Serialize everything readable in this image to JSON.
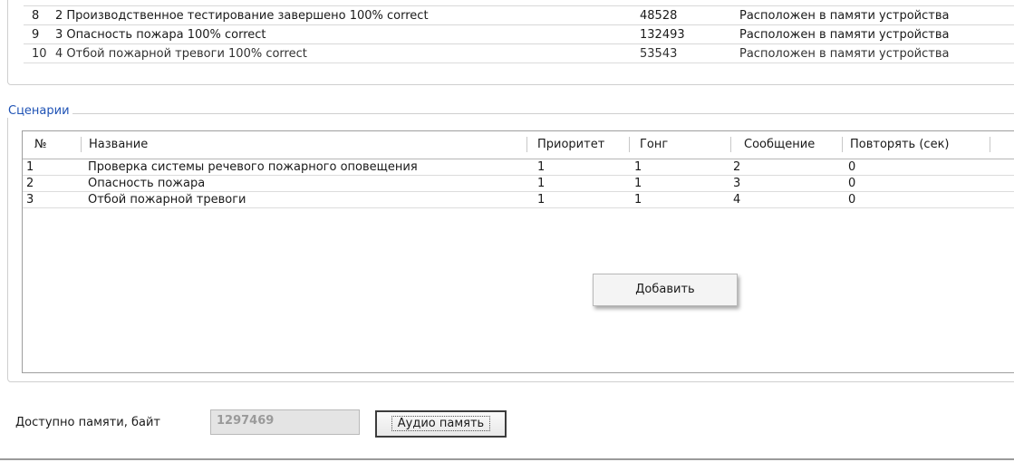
{
  "messages": {
    "rows": [
      {
        "num": "8",
        "name": "2 Производственное тестирование завершено 100% correct",
        "size": "48528",
        "location": "Расположен в памяти устройства"
      },
      {
        "num": "9",
        "name": "3 Опасность пожара 100% correct",
        "size": "132493",
        "location": "Расположен в памяти устройства"
      },
      {
        "num": "10",
        "name": "4 Отбой пожарной тревоги 100% correct",
        "size": "53543",
        "location": "Расположен в памяти устройства"
      }
    ]
  },
  "scenarios": {
    "legend": "Сценарии",
    "headers": {
      "num": "№",
      "name": "Название",
      "priority": "Приоритет",
      "gong": "Гонг",
      "message": "Сообщение",
      "repeat": "Повторять (сек)"
    },
    "rows": [
      {
        "num": "1",
        "name": "Проверка системы речевого пожарного оповещения",
        "priority": "1",
        "gong": "1",
        "message": "2",
        "repeat": "0"
      },
      {
        "num": "2",
        "name": "Опасность пожара",
        "priority": "1",
        "gong": "1",
        "message": "3",
        "repeat": "0"
      },
      {
        "num": "3",
        "name": "Отбой пожарной тревоги",
        "priority": "1",
        "gong": "1",
        "message": "4",
        "repeat": "0"
      }
    ],
    "add_label": "Добавить"
  },
  "memory": {
    "label": "Доступно памяти, байт",
    "value": "1297469",
    "audio_button": "Аудио память"
  }
}
